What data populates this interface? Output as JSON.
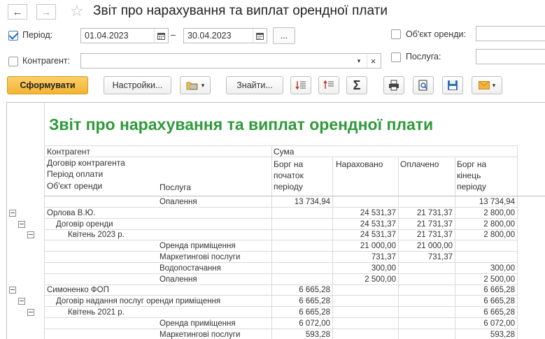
{
  "window": {
    "title": "Звіт про нарахування та виплат орендної плати"
  },
  "filters": {
    "period_label": "Період:",
    "period_checked": true,
    "date_from": "01.04.2023",
    "date_sep": "–",
    "date_to": "30.04.2023",
    "more_button": "...",
    "object_label": "Об'єкт оренди:",
    "contractor_label": "Контрагент:",
    "contractor_value": "",
    "service_label": "Послуга:"
  },
  "toolbar": {
    "generate": "Сформувати",
    "settings": "Настройки...",
    "find": "Знайти...",
    "sum_symbol": "Σ"
  },
  "report": {
    "title": "Звіт про нарахування та виплат орендної плати",
    "headers": {
      "contractor": "Контрагент",
      "contract": "Договір контрагента",
      "pay_period": "Період оплати",
      "object": "Об'єкт оренди",
      "service": "Послуга",
      "sum": "Сума",
      "debt_start": [
        "Борг на",
        "початок",
        "періоду"
      ],
      "accrued": "Нараховано",
      "paid": "Оплачено",
      "debt_end": [
        "Борг на",
        "кінець",
        "періоду"
      ]
    },
    "rows": [
      {
        "level": 4,
        "name": "",
        "service": "Опалення",
        "debt_start": "13 734,94",
        "accrued": "",
        "paid": "",
        "debt_end": "13 734,94"
      },
      {
        "level": 0,
        "name": "Орлова В.Ю.",
        "service": "",
        "debt_start": "",
        "accrued": "24 531,37",
        "paid": "21 731,37",
        "debt_end": "2 800,00"
      },
      {
        "level": 1,
        "name": "Договір оренди",
        "service": "",
        "debt_start": "",
        "accrued": "24 531,37",
        "paid": "21 731,37",
        "debt_end": "2 800,00"
      },
      {
        "level": 2,
        "name": "Квітень 2023 р.",
        "service": "",
        "debt_start": "",
        "accrued": "24 531,37",
        "paid": "21 731,37",
        "debt_end": "2 800,00"
      },
      {
        "level": 4,
        "name": "",
        "service": "Оренда приміщення",
        "debt_start": "",
        "accrued": "21 000,00",
        "paid": "21 000,00",
        "debt_end": ""
      },
      {
        "level": 4,
        "name": "",
        "service": "Маркетингові послуги",
        "debt_start": "",
        "accrued": "731,37",
        "paid": "731,37",
        "debt_end": ""
      },
      {
        "level": 4,
        "name": "",
        "service": "Водопостачання",
        "debt_start": "",
        "accrued": "300,00",
        "paid": "",
        "debt_end": "300,00"
      },
      {
        "level": 4,
        "name": "",
        "service": "Опалення",
        "debt_start": "",
        "accrued": "2 500,00",
        "paid": "",
        "debt_end": "2 500,00"
      },
      {
        "level": 0,
        "name": "Симоненко ФОП",
        "service": "",
        "debt_start": "6 665,28",
        "accrued": "",
        "paid": "",
        "debt_end": "6 665,28"
      },
      {
        "level": 1,
        "name": "Договір надання послуг оренди приміщення",
        "service": "",
        "debt_start": "6 665,28",
        "accrued": "",
        "paid": "",
        "debt_end": "6 665,28"
      },
      {
        "level": 2,
        "name": "Квітень 2021 р.",
        "service": "",
        "debt_start": "6 665,28",
        "accrued": "",
        "paid": "",
        "debt_end": "6 665,28"
      },
      {
        "level": 4,
        "name": "",
        "service": "Оренда приміщення",
        "debt_start": "6 072,00",
        "accrued": "",
        "paid": "",
        "debt_end": "6 072,00"
      },
      {
        "level": 4,
        "name": "",
        "service": "Маркетингові послуги",
        "debt_start": "593,28",
        "accrued": "",
        "paid": "",
        "debt_end": "593,28"
      }
    ]
  }
}
